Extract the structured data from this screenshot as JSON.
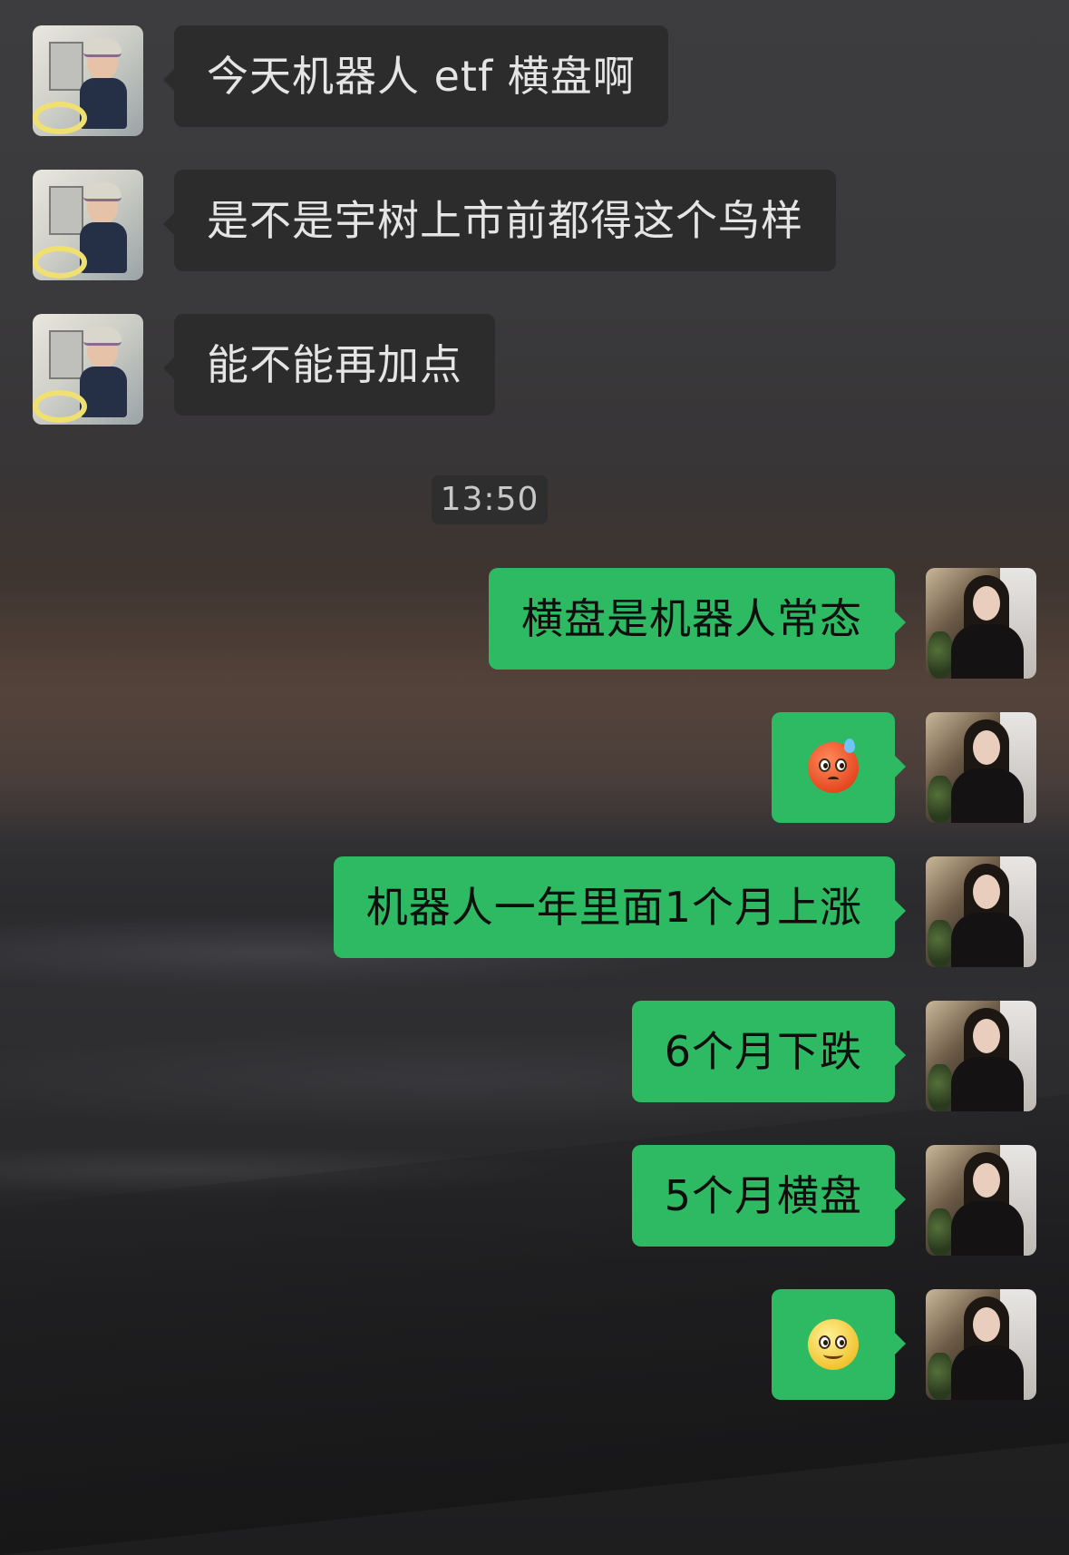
{
  "chat": {
    "timestamp": "13:50",
    "incoming": [
      {
        "text": "今天机器人 etf 横盘啊"
      },
      {
        "text": "是不是宇树上市前都得这个鸟样"
      },
      {
        "text": "能不能再加点"
      }
    ],
    "outgoing": [
      {
        "text": "横盘是机器人常态"
      },
      {
        "emoji": "sweat-face-emoji"
      },
      {
        "text": "机器人一年里面1个月上涨"
      },
      {
        "text": "6个月下跌"
      },
      {
        "text": "5个月横盘"
      },
      {
        "emoji": "smile-face-emoji"
      }
    ]
  },
  "colors": {
    "incoming_bubble": "#2c2c2c",
    "outgoing_bubble": "#2dba62",
    "timestamp_bg": "#2e2e2e"
  }
}
